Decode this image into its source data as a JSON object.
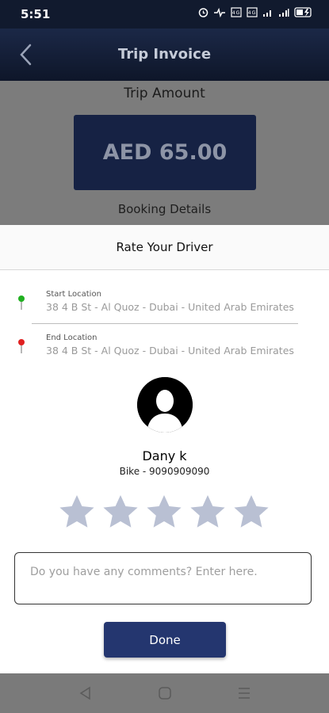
{
  "status_bar": {
    "time": "5:51",
    "icons": [
      "alarm-icon",
      "hotspot-icon",
      "volte-icon",
      "volte2-icon",
      "signal1-icon",
      "signal2-icon",
      "battery-icon"
    ]
  },
  "app_bar": {
    "title": "Trip Invoice"
  },
  "invoice": {
    "trip_amount_label": "Trip Amount",
    "amount": "AED 65.00",
    "booking_details_label": "Booking Details"
  },
  "rating_sheet": {
    "title": "Rate Your Driver",
    "start_location": {
      "label": "Start Location",
      "address": "38 4 B St - Al Quoz - Dubai - United Arab Emirates",
      "pin_color": "#20b020"
    },
    "end_location": {
      "label": "End Location",
      "address": "38 4 B St - Al Quoz - Dubai - United Arab Emirates",
      "pin_color": "#e02020"
    },
    "driver": {
      "name": "Dany k",
      "vehicle": "Bike - 9090909090"
    },
    "rating": {
      "max": 5,
      "selected": 0,
      "star_color": "#b9c0d3"
    },
    "comment_placeholder": "Do you have any comments? Enter here.",
    "done_label": "Done"
  },
  "colors": {
    "primary": "#24366f",
    "appbar": "#141f3a"
  }
}
